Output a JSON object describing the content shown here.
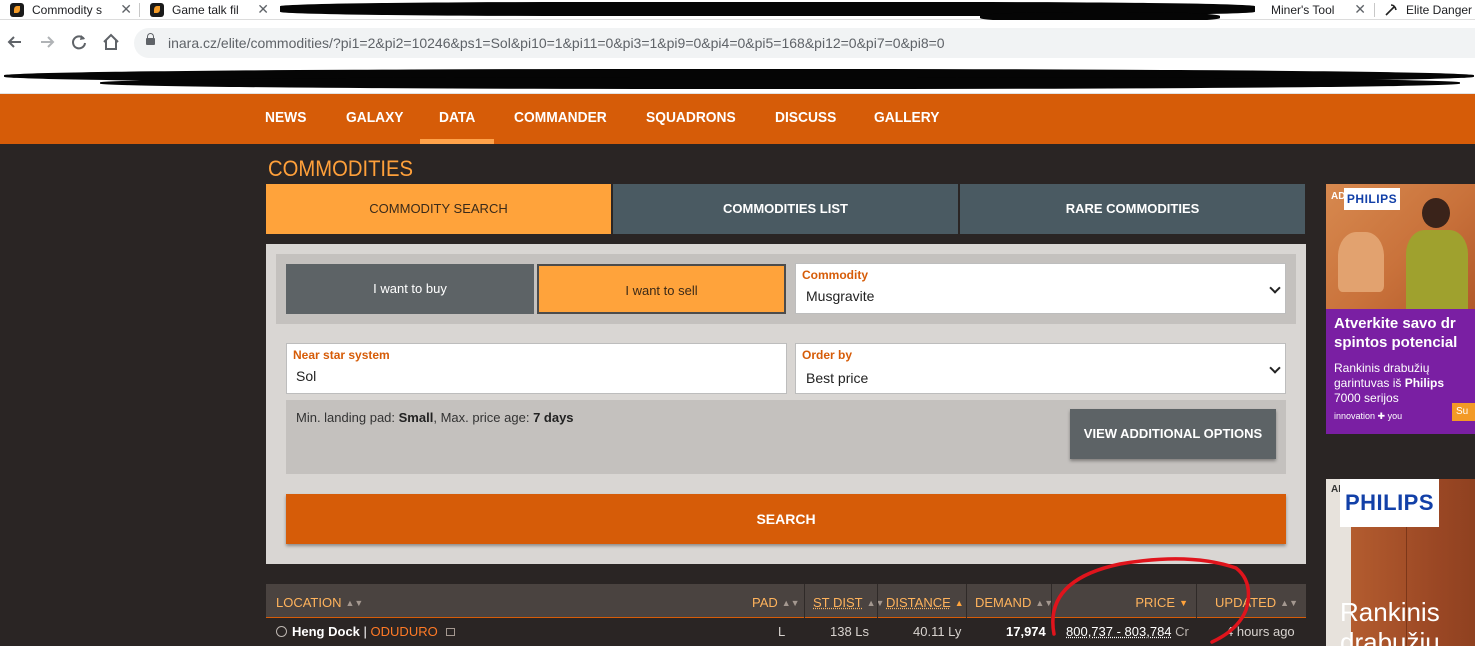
{
  "browser": {
    "tabs": [
      {
        "title": "Commodity s"
      },
      {
        "title": "Game talk fil"
      },
      {
        "title": "Miner's Tool"
      },
      {
        "title": "Elite Danger"
      }
    ],
    "url": "inara.cz/elite/commodities/?pi1=2&pi2=10246&ps1=Sol&pi10=1&pi11=0&pi3=1&pi9=0&pi4=0&pi5=168&pi12=0&pi7=0&pi8=0"
  },
  "site_nav": {
    "items": [
      "NEWS",
      "GALAXY",
      "DATA",
      "COMMANDER",
      "SQUADRONS",
      "DISCUSS",
      "GALLERY"
    ],
    "active": "DATA",
    "accent_color": "#d65c08"
  },
  "page": {
    "title": "COMMODITIES",
    "subtabs": [
      "COMMODITY SEARCH",
      "COMMODITIES LIST",
      "RARE COMMODITIES"
    ],
    "active_subtab": "COMMODITY SEARCH"
  },
  "search_form": {
    "buy_label": "I want to buy",
    "sell_label": "I want to sell",
    "selected_mode": "I want to sell",
    "commodity": {
      "label": "Commodity",
      "value": "Musgravite"
    },
    "near_star": {
      "label": "Near star system",
      "value": "Sol"
    },
    "order_by": {
      "label": "Order by",
      "value": "Best price"
    },
    "options": {
      "pad_label": "Min. landing pad:",
      "pad_value": "Small",
      "age_label": "Max. price age:",
      "age_value": "7 days"
    },
    "more_options_label": "VIEW ADDITIONAL OPTIONS",
    "search_label": "SEARCH"
  },
  "results": {
    "columns": [
      "LOCATION",
      "PAD",
      "ST DIST",
      "DISTANCE",
      "DEMAND",
      "PRICE",
      "UPDATED"
    ],
    "sorted_by": "PRICE",
    "rows": [
      {
        "station": "Heng Dock",
        "separator": "|",
        "system": "ODUDURO",
        "pad": "L",
        "st_dist": "138 Ls",
        "distance": "40.11 Ly",
        "demand": "17,974",
        "price": "800,737 - 803,784",
        "price_unit": "Cr",
        "updated": "4 hours ago"
      }
    ]
  },
  "ads": {
    "ad1": {
      "tag": "AD",
      "brand": "PHILIPS",
      "headline": "Atverkite savo dr spintos potencial",
      "body_line1": "Rankinis drabužių",
      "body_line2": "garintuvas iš",
      "body_brand": "Philips",
      "body_line3": "7000 serijos",
      "tagline": "innovation ✚ you",
      "cta": "Su"
    },
    "ad2": {
      "tag": "AD",
      "brand": "PHILIPS",
      "headline1": "Rankinis",
      "headline2": "drabužių"
    }
  },
  "annotation": {
    "color": "#e0141c"
  }
}
